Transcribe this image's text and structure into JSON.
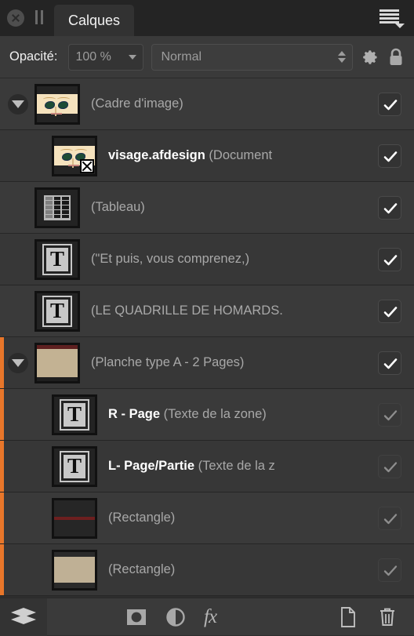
{
  "titlebar": {
    "close_icon": "close-circle-icon",
    "pause_icon": "pause-icon",
    "tab_label": "Calques",
    "menu_icon": "hamburger-menu-icon"
  },
  "options": {
    "opacity_label": "Opacité:",
    "opacity_value": "100 %",
    "blend_mode": "Normal",
    "gear_icon": "gear-icon",
    "lock_icon": "lock-icon"
  },
  "layers": [
    {
      "name": "(Cadre d'image)",
      "bold_prefix": "",
      "indent": 0,
      "disclosure": "expanded",
      "thumb": "face",
      "badge": "",
      "checked": true,
      "check_state": "active",
      "marker": false
    },
    {
      "name": "(Document",
      "bold_prefix": "visage.afdesign",
      "indent": 1,
      "disclosure": "none",
      "thumb": "face",
      "badge": "x-badge-icon",
      "checked": true,
      "check_state": "active",
      "marker": false
    },
    {
      "name": "(Tableau)",
      "bold_prefix": "",
      "indent": 0,
      "disclosure": "none",
      "thumb": "table",
      "badge": "",
      "checked": true,
      "check_state": "active",
      "marker": false
    },
    {
      "name": "(\"Et puis, vous comprenez,)",
      "bold_prefix": "",
      "indent": 0,
      "disclosure": "none",
      "thumb": "text",
      "badge": "",
      "checked": true,
      "check_state": "active",
      "marker": false
    },
    {
      "name": "(LE QUADRILLE DE HOMARDS.",
      "bold_prefix": "",
      "indent": 0,
      "disclosure": "none",
      "thumb": "text",
      "badge": "",
      "checked": true,
      "check_state": "active",
      "marker": false
    },
    {
      "name": "(Planche type A - 2 Pages)",
      "bold_prefix": "",
      "indent": 0,
      "disclosure": "expanded",
      "thumb": "plate",
      "badge": "",
      "checked": true,
      "check_state": "active",
      "marker": true
    },
    {
      "name": "(Texte de la zone)",
      "bold_prefix": "R - Page",
      "indent": 1,
      "disclosure": "none",
      "thumb": "text",
      "badge": "",
      "checked": true,
      "check_state": "dim",
      "marker": true
    },
    {
      "name": "(Texte de la z",
      "bold_prefix": "L- Page/Partie",
      "indent": 1,
      "disclosure": "none",
      "thumb": "text",
      "badge": "",
      "checked": true,
      "check_state": "dim",
      "marker": true
    },
    {
      "name": "(Rectangle)",
      "bold_prefix": "",
      "indent": 1,
      "disclosure": "none",
      "thumb": "rect1",
      "badge": "",
      "checked": true,
      "check_state": "dim",
      "marker": true
    },
    {
      "name": "(Rectangle)",
      "bold_prefix": "",
      "indent": 1,
      "disclosure": "none",
      "thumb": "rect2",
      "badge": "",
      "checked": true,
      "check_state": "dim",
      "marker": true
    }
  ],
  "bottombar": {
    "layers_icon": "layers-stack-icon",
    "mask_icon": "mask-icon",
    "adjustment_icon": "adjustment-icon",
    "fx_label": "fx",
    "new_icon": "new-document-icon",
    "trash_icon": "trash-icon"
  },
  "colors": {
    "accent_orange": "#e8762a",
    "panel_bg": "#2e2e2e",
    "row_bg": "#3a3a3a"
  }
}
